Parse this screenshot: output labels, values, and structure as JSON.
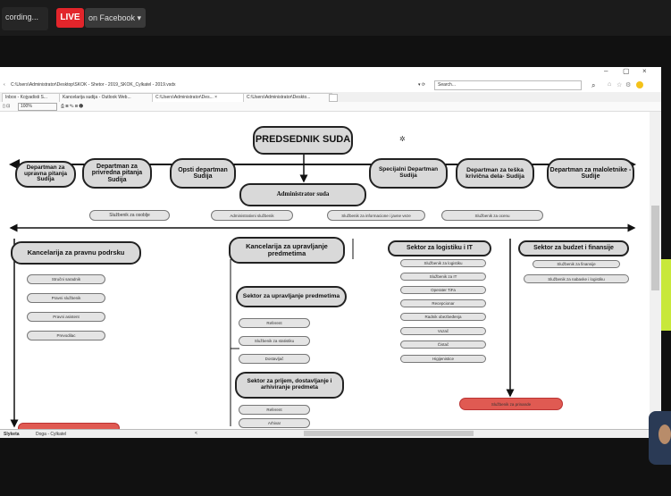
{
  "stream": {
    "recording_label": "cording...",
    "live_label": "LIVE",
    "facebook_label": "on Facebook ▾"
  },
  "browser": {
    "path": "C:\\Users\\Administrator\\Desktop\\SKOK - Shetor - 2019_SKOK_Cylkatel - 2019.vsdx",
    "search_placeholder": "Search...",
    "tabs": [
      "Inbox - Kojyadisti S...",
      "Kancelarija sudija - Outlook Web...",
      "C:\\Users\\Administrator\\Des...  ×",
      "C:\\Users\\Administrator\\Deskto..."
    ],
    "zoom": "100%",
    "sheet_tabs": [
      "Slyketa",
      "Doga - Cylkatel"
    ]
  },
  "chart": {
    "president": "PREDSEDNIK SUDA",
    "administrator": "Administrator suda",
    "departments": [
      "Departman za upravna pitanja Sudija",
      "Departman za privredna pitanja Sudija",
      "Opsti departman Sudija",
      "Specijalni Departman Sudija",
      "Departman za teška krivična dela- Sudija",
      "Departman za maloletnike - Sudije"
    ],
    "admin_staff": [
      "Službenik za osoblje",
      "Administrativni službenik",
      "Službenik za informacione i javne veze",
      "Službenik za ocenu"
    ],
    "legal_support": {
      "title": "Kancelarija za pravnu podrsku",
      "items": [
        "Stručni saradnik",
        "Pravni službenik",
        "Pravni asistent",
        "Prevodilac"
      ]
    },
    "case_mgmt": {
      "title": "Kancelarija za upravljanje predmetima",
      "sub1_title": "Sektor za upravljanje predmetima",
      "sub1_items": [
        "Referent",
        "Službenik za statistiku",
        "Dostavljač"
      ],
      "sub2_title": "Sektor za prijem, dostavljanje i arhiviranje predmeta",
      "sub2_items": [
        "Referent",
        "Arhivar"
      ]
    },
    "logistics": {
      "title": "Sektor za logistiku i IT",
      "items": [
        "Službenik za logistiku",
        "Službenik za IT",
        "Operater TiFa",
        "Recepcionar",
        "Radnik obezbeđenja",
        "Vozač",
        "Čistač",
        "Higijenistice"
      ]
    },
    "budget": {
      "title": "Sektor za budzet i finansije",
      "items": [
        "Službenik za finansije",
        "Službenik za nabavke i logistiku"
      ],
      "red_item": "Službenik za prinande"
    }
  }
}
